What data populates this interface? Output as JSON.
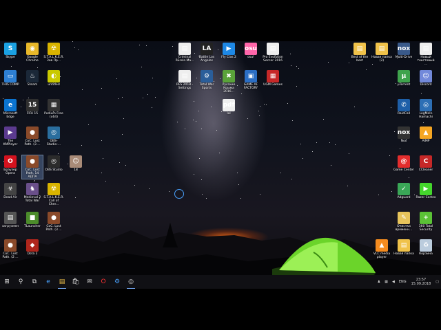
{
  "desktop_icons": [
    {
      "id": "skype",
      "label": "Skype",
      "color": "#1ba1e2",
      "glyph": "S"
    },
    {
      "id": "chrome",
      "label": "Google Chrome",
      "color": "#e8b82a",
      "glyph": "◉"
    },
    {
      "id": "stalker",
      "label": "S.T.A.L.K.E.R. Зов Пр...",
      "color": "#d9b400",
      "glyph": "☢"
    },
    {
      "id": "thiscomp",
      "label": "THIS COMP",
      "color": "#2d7fd3",
      "glyph": "▭"
    },
    {
      "id": "steam",
      "label": "Steam",
      "color": "#1b2838",
      "glyph": "♨"
    },
    {
      "id": "untitled",
      "label": "untitled",
      "color": "#c9c900",
      "glyph": "◐"
    },
    {
      "id": "edge",
      "label": "Microsoft Edge",
      "color": "#0b74d0",
      "glyph": "e"
    },
    {
      "id": "fifa",
      "label": "FIFA 15",
      "color": "#2f2f2f",
      "glyph": "15"
    },
    {
      "id": "podium",
      "label": "Podium Free (x64)",
      "color": "#333",
      "glyph": "▦"
    },
    {
      "id": "kmplayer",
      "label": "The KMPlayer",
      "color": "#5b3a8f",
      "glyph": "▶"
    },
    {
      "id": "coc1",
      "label": "CoC. Lost Path. (3 ...",
      "color": "#8a4a2a",
      "glyph": "●"
    },
    {
      "id": "obs",
      "label": "OBS-Studio-...",
      "color": "#2a6e9e",
      "glyph": "◎"
    },
    {
      "id": "opera",
      "label": "Браузер Opera",
      "color": "#d4121e",
      "glyph": "O"
    },
    {
      "id": "coc2",
      "label": "CoC. Lost Path. 14 АДПА",
      "color": "#8a4a2a",
      "glyph": "●"
    },
    {
      "id": "obsstudio",
      "label": "OBS Studio",
      "color": "#2b2b2b",
      "glyph": "◎"
    },
    {
      "id": "num18",
      "label": "18",
      "color": "#a98b78",
      "glyph": "☺"
    },
    {
      "id": "deadair",
      "label": "Dead Air",
      "color": "#444",
      "glyph": "☣"
    },
    {
      "id": "medieval",
      "label": "Medieval 2 Total War",
      "color": "#6a4f8a",
      "glyph": "♞"
    },
    {
      "id": "callofcher",
      "label": "S.T.A.L.K.E.R. Call of Cher...",
      "color": "#d9b400",
      "glyph": "☢"
    },
    {
      "id": "zagruzh",
      "label": "загрузмен",
      "color": "#555",
      "glyph": "▤"
    },
    {
      "id": "tlauncher",
      "label": "TLauncher",
      "color": "#4c8c2b",
      "glyph": "■"
    },
    {
      "id": "coc3",
      "label": "CoC. Lost Path. (3 ...",
      "color": "#8a4a2a",
      "glyph": "●"
    },
    {
      "id": "coc4",
      "label": "CoC. Lost Path. (2 ...",
      "color": "#8a4a2a",
      "glyph": "●"
    },
    {
      "id": "dota2",
      "label": "Dota 2",
      "color": "#b0261c",
      "glyph": "◆"
    },
    {
      "id": "criminal",
      "label": "Criminal Russia Ma...",
      "color": "#eee",
      "glyph": "▤"
    },
    {
      "id": "battlelos",
      "label": "Battle Los Angeles",
      "color": "#222",
      "glyph": "LA"
    },
    {
      "id": "flyclas",
      "label": "Fly Clas 2",
      "color": "#1e88e5",
      "glyph": "▶"
    },
    {
      "id": "osu",
      "label": "osu!",
      "color": "#ff66aa",
      "glyph": "osu"
    },
    {
      "id": "pes2016",
      "label": "Pro Evolution Soccer 2016",
      "color": "#eee",
      "glyph": "▤"
    },
    {
      "id": "pes2018",
      "label": "PES 2018 - Settings",
      "color": "#eee",
      "glyph": "▤"
    },
    {
      "id": "totalwar",
      "label": "Total War Sports",
      "color": "#2a5e9a",
      "glyph": "⚙"
    },
    {
      "id": "rusmaps",
      "label": "Русские Крыма 2016...",
      "color": "#5aa33a",
      "glyph": "✖"
    },
    {
      "id": "gameaf",
      "label": "GAME AF FACTORY",
      "color": "#2b6ec4",
      "glyph": "▣"
    },
    {
      "id": "ugmgames",
      "label": "UGM Games",
      "color": "#c62828",
      "glyph": "▦"
    },
    {
      "id": "pdf",
      "label": "lol",
      "color": "#eee",
      "glyph": "pdf"
    },
    {
      "id": "bestof",
      "label": "Best of the best",
      "color": "#f0c24a",
      "glyph": "▤"
    },
    {
      "id": "newfolder2",
      "label": "Новая папка (2)",
      "color": "#f0c24a",
      "glyph": "▤"
    },
    {
      "id": "multidrive",
      "label": "Multi-Drive",
      "color": "#3a5a8a",
      "glyph": "nox"
    },
    {
      "id": "newtext",
      "label": "Новый текстовый ...",
      "color": "#eee",
      "glyph": "▤"
    },
    {
      "id": "utorrent",
      "label": "µTorrent",
      "color": "#3fa34d",
      "glyph": "µ"
    },
    {
      "id": "discord",
      "label": "Discord",
      "color": "#7289da",
      "glyph": "☺"
    },
    {
      "id": "raidcall",
      "label": "RaidCall",
      "color": "#1e5fa8",
      "glyph": "✆"
    },
    {
      "id": "logmein",
      "label": "LogMeIn Hamachi",
      "color": "#2d6fb5",
      "glyph": "◎"
    },
    {
      "id": "nox",
      "label": "Nox",
      "color": "#333",
      "glyph": "nox"
    },
    {
      "id": "aimp",
      "label": "AIMP",
      "color": "#f5a623",
      "glyph": "▲"
    },
    {
      "id": "gamecenter",
      "label": "Game Center",
      "color": "#e32d2d",
      "glyph": "@"
    },
    {
      "id": "ccleaner",
      "label": "CCleaner",
      "color": "#c62828",
      "glyph": "C"
    },
    {
      "id": "adguard",
      "label": "Adguard",
      "color": "#3aa757",
      "glyph": "✓"
    },
    {
      "id": "razor",
      "label": "Razer Cortex",
      "color": "#44d62c",
      "glyph": "▶"
    },
    {
      "id": "cleaner",
      "label": "Очистка временн...",
      "color": "#e8c45b",
      "glyph": "✎"
    },
    {
      "id": "security360",
      "label": "360 Total Security",
      "color": "#5bc236",
      "glyph": "+"
    },
    {
      "id": "vlc",
      "label": "VLC media player",
      "color": "#f48b1f",
      "glyph": "▲"
    },
    {
      "id": "newfolder",
      "label": "Новая папка",
      "color": "#f0c24a",
      "glyph": "▤"
    },
    {
      "id": "recycle",
      "label": "Корзина",
      "color": "#bcd",
      "glyph": "♻"
    }
  ],
  "taskbar": {
    "search_glyph": "⚲",
    "taskview_glyph": "⧉",
    "apps": [
      {
        "id": "edge",
        "glyph": "e",
        "color": "#4aa3ff"
      },
      {
        "id": "explorer",
        "glyph": "▤",
        "color": "#f0c24a"
      },
      {
        "id": "store",
        "glyph": "🛍",
        "color": "#ddd"
      },
      {
        "id": "mail",
        "glyph": "✉",
        "color": "#ddd"
      },
      {
        "id": "opera",
        "glyph": "O",
        "color": "#ff3333"
      },
      {
        "id": "unknown",
        "glyph": "⚙",
        "color": "#4aa3ff"
      },
      {
        "id": "obs",
        "glyph": "◎",
        "color": "#ddd"
      }
    ],
    "tray": {
      "language": "ENG",
      "time": "23:57",
      "date": "15.09.2018"
    }
  }
}
